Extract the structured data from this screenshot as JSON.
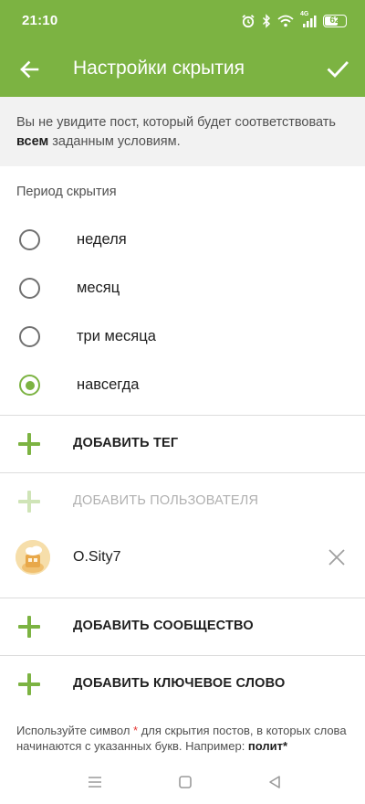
{
  "status_bar": {
    "time": "21:10",
    "network": "4G",
    "battery": "62",
    "icons": [
      "alarm-icon",
      "bluetooth-icon",
      "wifi-icon",
      "signal-icon",
      "battery-icon"
    ]
  },
  "toolbar": {
    "title": "Настройки скрытия",
    "back_icon": "arrow-left-icon",
    "confirm_icon": "checkmark-icon"
  },
  "info": {
    "text_before": "Вы не увидите пост, который будет соответствовать ",
    "text_bold": "всем",
    "text_after": " заданным условиям."
  },
  "period": {
    "label": "Период скрытия",
    "options": [
      {
        "label": "неделя",
        "selected": false
      },
      {
        "label": "месяц",
        "selected": false
      },
      {
        "label": "три месяца",
        "selected": false
      },
      {
        "label": "навсегда",
        "selected": true
      }
    ]
  },
  "actions": {
    "add_tag": "ДОБАВИТЬ ТЕГ",
    "add_user": "ДОБАВИТЬ ПОЛЬЗОВАТЕЛЯ",
    "add_community": "ДОБАВИТЬ СООБЩЕСТВО",
    "add_keyword": "ДОБАВИТЬ КЛЮЧЕВОЕ СЛОВО"
  },
  "user": {
    "name": "O.Sity7"
  },
  "hint": {
    "before": "Используйте символ ",
    "star": "*",
    "middle": " для скрытия постов, в которых слова начинаются с указанных букв. Например: ",
    "example": "полит*"
  },
  "colors": {
    "accent": "#7cb342",
    "accent_disabled": "#cfe4b7",
    "info_bg": "#f2f2f2",
    "star": "#e53935"
  },
  "nav_bar": {
    "icons": [
      "menu-icon",
      "home-square-icon",
      "back-triangle-icon"
    ]
  }
}
